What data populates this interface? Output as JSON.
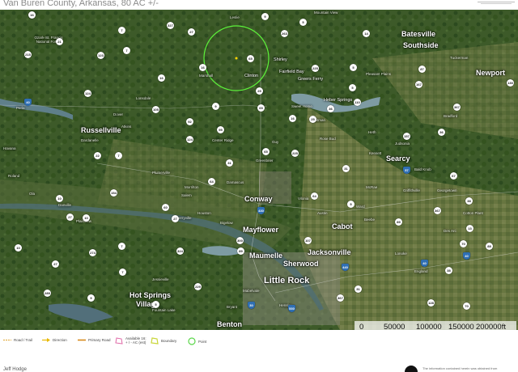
{
  "title": "Van Buren County, Arkansas, 80 AC +/-",
  "map": {
    "cities_large": [
      {
        "name": "Conway"
      },
      {
        "name": "Mayflower"
      },
      {
        "name": "Maumelle"
      },
      {
        "name": "Sherwood"
      },
      {
        "name": "Jacksonville"
      },
      {
        "name": "Cabot"
      },
      {
        "name": "Searcy"
      },
      {
        "name": "Russellville"
      },
      {
        "name": "Batesville"
      },
      {
        "name": "Southside"
      },
      {
        "name": "Newport"
      },
      {
        "name": "Benton"
      },
      {
        "name": "Hot Springs"
      },
      {
        "name": "Village"
      }
    ],
    "city_little_rock": "Little Rock",
    "cities_small": [
      "Ozark-St. Francis National Forest",
      "Clinton",
      "Shirley",
      "Fairfield Bay",
      "Greers Ferry",
      "Heber Springs",
      "Quitman",
      "Rose Bud",
      "Vilonia",
      "Morrilton",
      "Dardanelle",
      "Dover",
      "Atkins",
      "Plumerville",
      "Houston",
      "Perryville",
      "Bigelow",
      "Beebe",
      "Ward",
      "Austin",
      "Lonoke",
      "England",
      "Bryant",
      "Mabelvale",
      "Bald Knob",
      "Bradford",
      "Tuckerman",
      "Pleasant Plains",
      "Mountain View",
      "Leslie",
      "Marshall",
      "Judsonia",
      "Kensett",
      "Heth",
      "Greenbrier",
      "Guy",
      "Damascus",
      "Center Ridge",
      "Danville",
      "Plainview",
      "Fountain Lake",
      "Jessieville",
      "Hensley",
      "Des Arc",
      "Cotton Plant",
      "Georgetown",
      "Griffithville",
      "McRae",
      "Sweet Home",
      "Lonsdale",
      "Perla",
      "Salem",
      "Roland",
      "Ola",
      "Havana"
    ],
    "route_shields": [
      "16",
      "7",
      "327",
      "27",
      "65",
      "5",
      "9",
      "263",
      "14",
      "21",
      "215",
      "123",
      "7",
      "16",
      "16",
      "65",
      "25",
      "225",
      "5",
      "110",
      "87",
      "167",
      "367",
      "5",
      "124",
      "105",
      "92",
      "124",
      "9",
      "95",
      "25",
      "36",
      "16",
      "157",
      "36",
      "31",
      "22",
      "7",
      "65",
      "225",
      "64",
      "31",
      "67",
      "154",
      "10",
      "27",
      "10",
      "64",
      "60",
      "300",
      "27",
      "367",
      "89",
      "5",
      "107",
      "89",
      "367",
      "38",
      "13",
      "274",
      "7",
      "10",
      "27",
      "324",
      "7",
      "38",
      "289",
      "229",
      "9",
      "5",
      "31",
      "70",
      "128",
      "70",
      "88",
      "130"
    ],
    "interstates": [
      "40",
      "30",
      "430",
      "440",
      "530",
      "40",
      "40",
      "57"
    ],
    "scale": {
      "labels": [
        "0",
        "50000",
        "100000",
        "150000",
        "200000ft"
      ]
    }
  },
  "legend": [
    {
      "label": "Road / Trail",
      "color": "#e0a42a"
    },
    {
      "label": "Direction",
      "color": "#e8b800"
    },
    {
      "label": "Primary Road",
      "color": "#d78a1c"
    },
    {
      "label": "Available 16:\n+ / - AC (est)",
      "color": "#e06aa8"
    },
    {
      "label": "Boundary",
      "color": "#c9d63a"
    },
    {
      "label": "Point",
      "color": "#5bd64a"
    }
  ],
  "footer": {
    "left": "Jeff Hodge",
    "note": "The information contained herein was obtained from"
  },
  "colors": {
    "circle": "#5cf23a",
    "water": "#6f8f9a",
    "forest": "#2f4d22",
    "field": "#6f7f45"
  }
}
